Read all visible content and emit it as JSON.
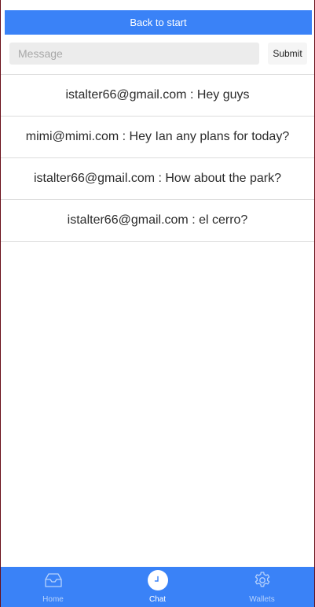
{
  "header": {
    "back_label": "Back to start"
  },
  "compose": {
    "placeholder": "Message",
    "value": "",
    "submit_label": "Submit"
  },
  "messages": [
    {
      "text": "istalter66@gmail.com : Hey guys"
    },
    {
      "text": "mimi@mimi.com : Hey Ian any plans for today?"
    },
    {
      "text": "istalter66@gmail.com : How about the park?"
    },
    {
      "text": "istalter66@gmail.com : el cerro?"
    }
  ],
  "tabbar": {
    "tabs": [
      {
        "label": "Home",
        "icon": "inbox-icon",
        "active": false
      },
      {
        "label": "Chat",
        "icon": "clock-icon",
        "active": true
      },
      {
        "label": "Wallets",
        "icon": "gear-icon",
        "active": false
      }
    ]
  },
  "colors": {
    "accent": "#3a82f7",
    "tab_inactive_label": "#b7d2fc",
    "page_backdrop": "#6a0f1a"
  }
}
